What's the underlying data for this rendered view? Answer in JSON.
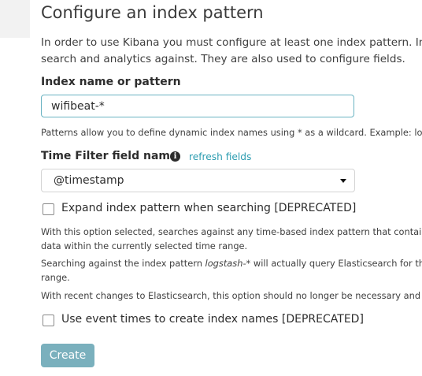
{
  "page": {
    "title": "Configure an index pattern",
    "intro_line_1": "In order to use Kibana you must configure at least one index pattern. Ind",
    "intro_line_2": "search and analytics against. They are also used to configure fields."
  },
  "index_pattern": {
    "label": "Index name or pattern",
    "value": "wifibeat-*",
    "help": "Patterns allow you to define dynamic index names using * as a wildcard. Example: logst"
  },
  "time_filter": {
    "label": "Time Filter field name",
    "info_icon": "info-icon",
    "refresh_label": "refresh fields",
    "selected": "@timestamp"
  },
  "expand_option": {
    "label": "Expand index pattern when searching [DEPRECATED]",
    "checked": false,
    "note_1_line_1": "With this option selected, searches against any time-based index pattern that contains a",
    "note_1_line_2": "data within the currently selected time range.",
    "note_2_before": "Searching against the index pattern ",
    "note_2_emph": "logstash-*",
    "note_2_after": " will actually query Elasticsearch for the s",
    "note_2_line_2": "range.",
    "note_3": "With recent changes to Elasticsearch, this option should no longer be necessary and wil"
  },
  "event_times_option": {
    "label": "Use event times to create index names [DEPRECATED]",
    "checked": false
  },
  "actions": {
    "create_label": "Create"
  },
  "colors": {
    "link": "#2b9cb0",
    "input_focus_border": "#69b3c2",
    "create_button_bg": "#7ab0bd"
  }
}
